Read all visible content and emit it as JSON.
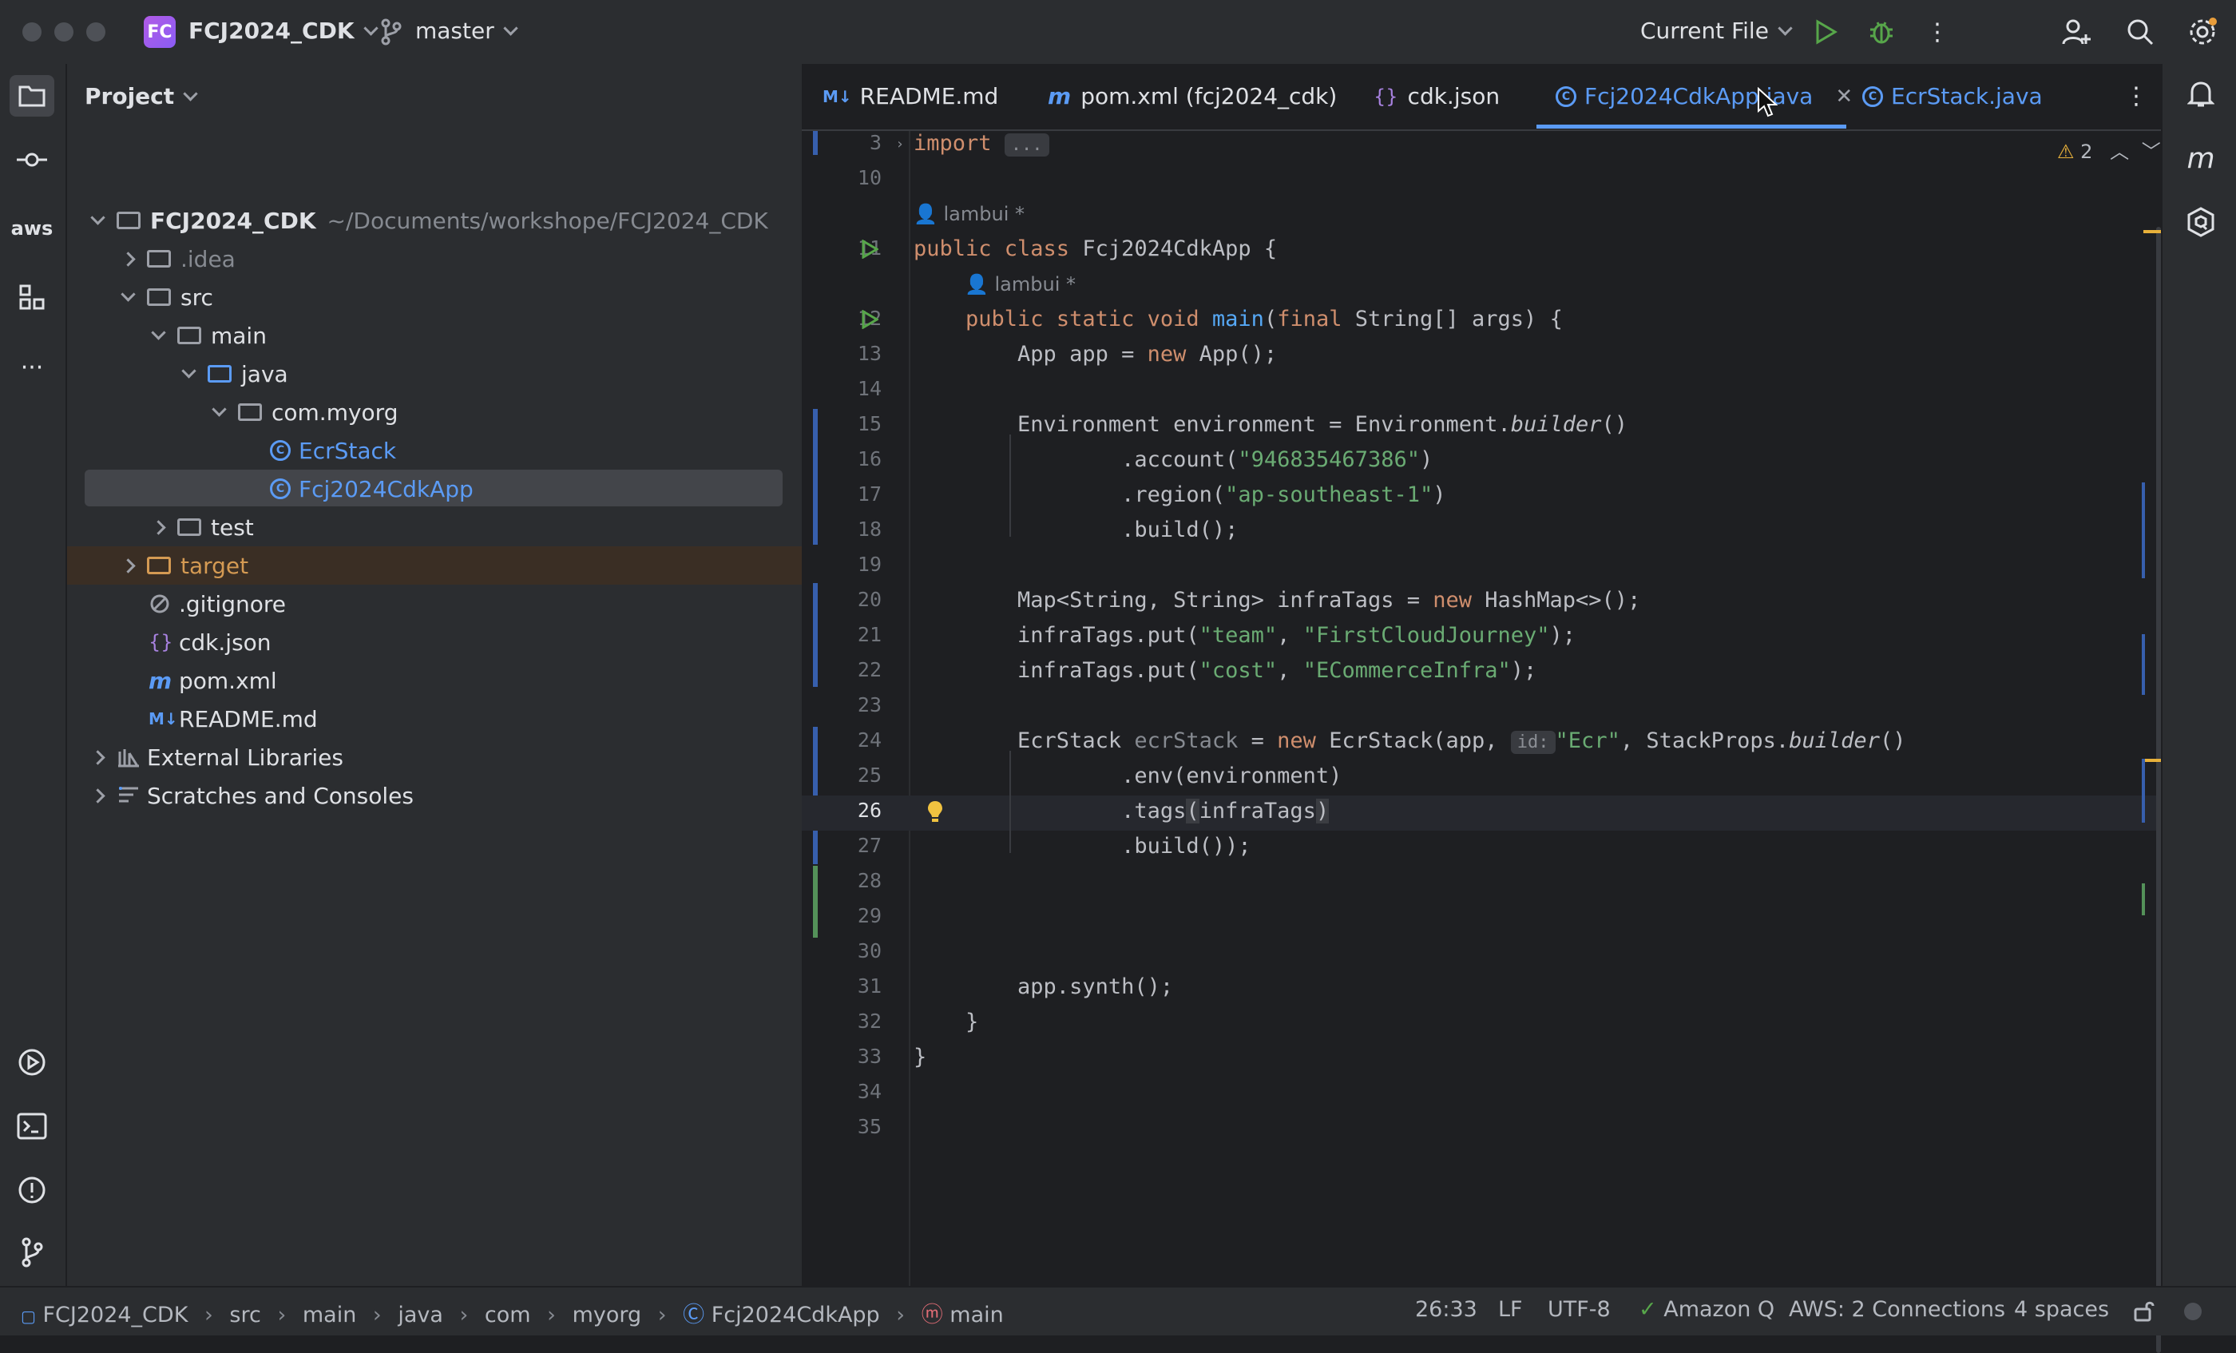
{
  "titlebar": {
    "project_badge": "FC",
    "project_name": "FCJ2024_CDK",
    "branch": "master",
    "run_config": "Current File"
  },
  "project_panel": {
    "title": "Project",
    "root_name": "FCJ2024_CDK",
    "root_path": "~/Documents/workshope/FCJ2024_CDK",
    "items": [
      {
        "label": ".idea"
      },
      {
        "label": "src"
      },
      {
        "label": "main"
      },
      {
        "label": "java"
      },
      {
        "label": "com.myorg"
      },
      {
        "label": "EcrStack"
      },
      {
        "label": "Fcj2024CdkApp"
      },
      {
        "label": "test"
      },
      {
        "label": "target"
      },
      {
        "label": ".gitignore"
      },
      {
        "label": "cdk.json"
      },
      {
        "label": "pom.xml"
      },
      {
        "label": "README.md"
      },
      {
        "label": "External Libraries"
      },
      {
        "label": "Scratches and Consoles"
      }
    ]
  },
  "tabs": [
    {
      "label": "README.md",
      "icon": "M↓"
    },
    {
      "label": "pom.xml (fcj2024_cdk)",
      "icon": "m"
    },
    {
      "label": "cdk.json",
      "icon": "{}"
    },
    {
      "label": "Fcj2024CdkApp.java",
      "icon": "C"
    },
    {
      "label": "EcrStack.java",
      "icon": "C"
    }
  ],
  "editor": {
    "warning_count": "2",
    "author": "lambui *",
    "line_numbers": [
      "3",
      "10",
      "11",
      "12",
      "13",
      "14",
      "15",
      "16",
      "17",
      "18",
      "19",
      "20",
      "21",
      "22",
      "23",
      "24",
      "25",
      "26",
      "27",
      "28",
      "29",
      "30",
      "31",
      "32",
      "33",
      "34",
      "35"
    ],
    "inlay_hint": "id:"
  },
  "statusbar": {
    "breadcrumbs": [
      "FCJ2024_CDK",
      "src",
      "main",
      "java",
      "com",
      "myorg",
      "Fcj2024CdkApp",
      "main"
    ],
    "position": "26:33",
    "line_sep": "LF",
    "encoding": "UTF-8",
    "amazon_q": "Amazon Q",
    "aws": "AWS: 2 Connections",
    "indent": "4 spaces"
  }
}
